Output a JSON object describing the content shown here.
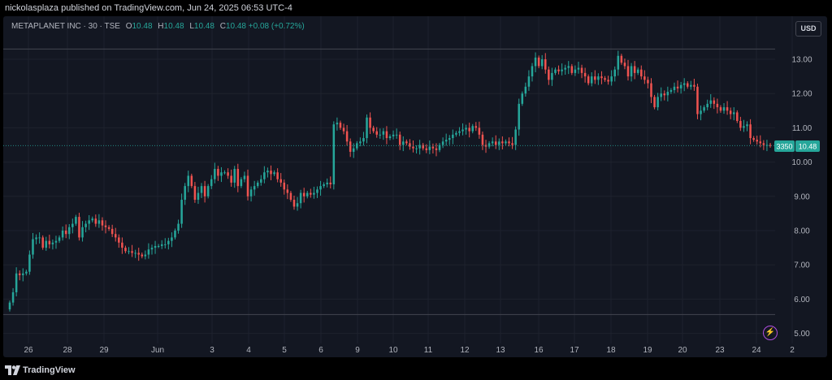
{
  "header": {
    "publisher": "nickolasplaza published on TradingView.com, Jun 24, 2025 06:53 UTC-4"
  },
  "legend": {
    "symbol": "METAPLANET INC · 30 · TSE",
    "open_label": "O",
    "open": "10.48",
    "high_label": "H",
    "high": "10.48",
    "low_label": "L",
    "low": "10.48",
    "close_label": "C",
    "close": "10.48",
    "change": "+0.08 (+0.72%)"
  },
  "toolbar": {
    "currency": "USD"
  },
  "price_tags": {
    "countdown": "3350",
    "last_price": "10.48"
  },
  "footer": {
    "brand": "TradingView"
  },
  "colors": {
    "up": "#26a69a",
    "down": "#ef5350",
    "background": "#131722",
    "accent_bolt": "#c062f0"
  },
  "icons": {
    "bolt": "lightning-bolt-icon",
    "logo": "tradingview-logo-icon"
  },
  "chart_data": {
    "type": "candlestick",
    "interval": "30 min",
    "y_axis": {
      "min": 4.8,
      "max": 13.5,
      "ticks": [
        "5.00",
        "6.00",
        "7.00",
        "8.00",
        "9.00",
        "10.00",
        "11.00",
        "12.00",
        "13.00"
      ],
      "side": "right"
    },
    "x_axis": {
      "ticks": [
        "26",
        "28",
        "29",
        "Jun",
        "3",
        "4",
        "5",
        "6",
        "9",
        "10",
        "11",
        "12",
        "13",
        "16",
        "17",
        "18",
        "19",
        "20",
        "23",
        "24",
        "2"
      ]
    },
    "reference_lines": [
      13.3,
      5.55
    ],
    "last_price": 10.48,
    "grid": true,
    "closes": [
      5.9,
      6.2,
      6.75,
      6.7,
      6.75,
      6.8,
      7.3,
      7.75,
      7.8,
      7.8,
      7.5,
      7.7,
      7.6,
      7.65,
      7.7,
      7.8,
      8.0,
      7.9,
      8.1,
      8.2,
      8.4,
      7.8,
      8.1,
      8.2,
      8.3,
      8.35,
      8.2,
      8.3,
      8.15,
      8.1,
      8.05,
      7.9,
      7.8,
      7.65,
      7.5,
      7.4,
      7.4,
      7.35,
      7.35,
      7.3,
      7.25,
      7.3,
      7.45,
      7.5,
      7.55,
      7.55,
      7.6,
      7.6,
      7.7,
      7.8,
      8.0,
      8.2,
      8.9,
      9.3,
      9.6,
      9.3,
      8.9,
      9.1,
      9.3,
      9.0,
      9.3,
      9.5,
      9.8,
      9.6,
      9.7,
      9.7,
      9.6,
      9.4,
      9.8,
      9.3,
      9.5,
      9.6,
      9.0,
      9.2,
      9.3,
      9.4,
      9.5,
      9.7,
      9.75,
      9.65,
      9.7,
      9.5,
      9.4,
      9.2,
      9.1,
      8.9,
      8.7,
      8.8,
      9.1,
      9.0,
      9.1,
      9.05,
      9.1,
      9.2,
      9.3,
      9.35,
      9.4,
      9.35,
      11.1,
      11.15,
      11.0,
      10.9,
      10.6,
      10.3,
      10.4,
      10.55,
      10.6,
      10.7,
      11.3,
      11.0,
      10.9,
      10.8,
      10.8,
      10.9,
      10.7,
      10.75,
      10.8,
      10.8,
      10.5,
      10.6,
      10.55,
      10.45,
      10.4,
      10.4,
      10.5,
      10.4,
      10.35,
      10.45,
      10.4,
      10.35,
      10.5,
      10.6,
      10.65,
      10.7,
      10.8,
      10.85,
      10.9,
      10.95,
      11.0,
      10.9,
      11.05,
      11.0,
      10.8,
      10.5,
      10.45,
      10.55,
      10.6,
      10.5,
      10.6,
      10.55,
      10.6,
      10.55,
      10.5,
      10.95,
      11.7,
      12.0,
      12.2,
      12.5,
      12.8,
      13.05,
      12.8,
      13.0,
      12.7,
      12.4,
      12.6,
      12.7,
      12.65,
      12.7,
      12.75,
      12.8,
      12.6,
      12.7,
      12.75,
      12.6,
      12.5,
      12.3,
      12.5,
      12.4,
      12.5,
      12.45,
      12.4,
      12.35,
      12.5,
      12.7,
      13.1,
      12.9,
      12.8,
      12.5,
      12.8,
      12.6,
      12.7,
      12.5,
      12.4,
      12.3,
      11.9,
      11.6,
      11.9,
      12.0,
      11.95,
      12.05,
      12.1,
      12.2,
      12.15,
      12.25,
      12.3,
      12.2,
      12.25,
      12.2,
      11.4,
      11.5,
      11.6,
      11.7,
      11.8,
      11.7,
      11.6,
      11.5,
      11.6,
      11.5,
      11.4,
      11.45,
      11.2,
      11.0,
      11.05,
      11.1,
      10.7,
      10.65,
      10.6,
      10.55,
      10.5,
      10.5,
      10.48
    ]
  }
}
